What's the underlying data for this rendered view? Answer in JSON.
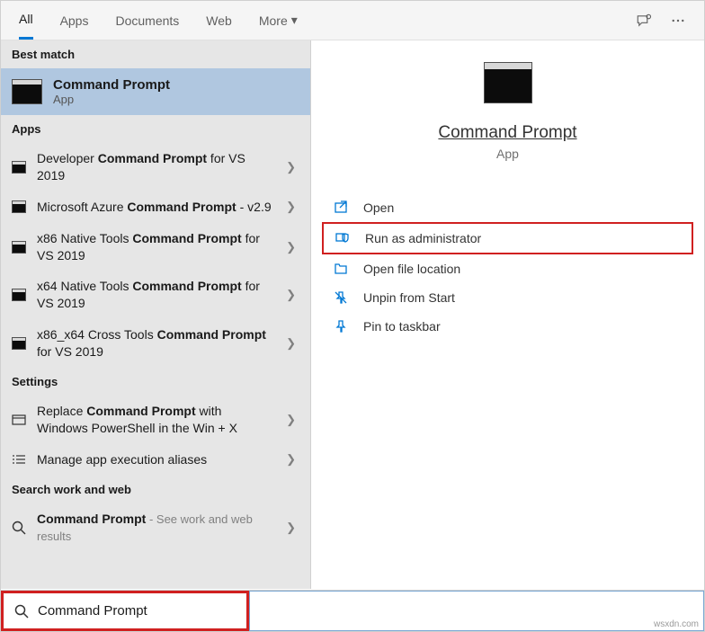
{
  "tabs": {
    "all": "All",
    "apps": "Apps",
    "documents": "Documents",
    "web": "Web",
    "more": "More"
  },
  "sections": {
    "best_match": "Best match",
    "apps": "Apps",
    "settings": "Settings",
    "search_work_web": "Search work and web"
  },
  "best_match": {
    "title": "Command Prompt",
    "subtitle": "App"
  },
  "apps_list": [
    {
      "pre": "Developer ",
      "bold": "Command Prompt",
      "post": " for VS 2019"
    },
    {
      "pre": "Microsoft Azure ",
      "bold": "Command Prompt",
      "post": " - v2.9"
    },
    {
      "pre": "x86 Native Tools ",
      "bold": "Command Prompt",
      "post": " for VS 2019"
    },
    {
      "pre": "x64 Native Tools ",
      "bold": "Command Prompt",
      "post": " for VS 2019"
    },
    {
      "pre": "x86_x64 Cross Tools ",
      "bold": "Command Prompt",
      "post": " for VS 2019"
    }
  ],
  "settings_list": [
    {
      "pre": "Replace ",
      "bold": "Command Prompt",
      "post": " with Windows PowerShell in the Win + X"
    },
    {
      "pre": "",
      "bold": "",
      "post": "Manage app execution aliases"
    }
  ],
  "web_list": [
    {
      "bold": "Command Prompt",
      "hint": " - See work and web results"
    }
  ],
  "preview": {
    "title": "Command Prompt",
    "subtitle": "App"
  },
  "actions": {
    "open": "Open",
    "run_admin": "Run as administrator",
    "open_location": "Open file location",
    "unpin_start": "Unpin from Start",
    "pin_taskbar": "Pin to taskbar"
  },
  "search": {
    "value": "Command Prompt"
  },
  "watermark": "wsxdn.com"
}
